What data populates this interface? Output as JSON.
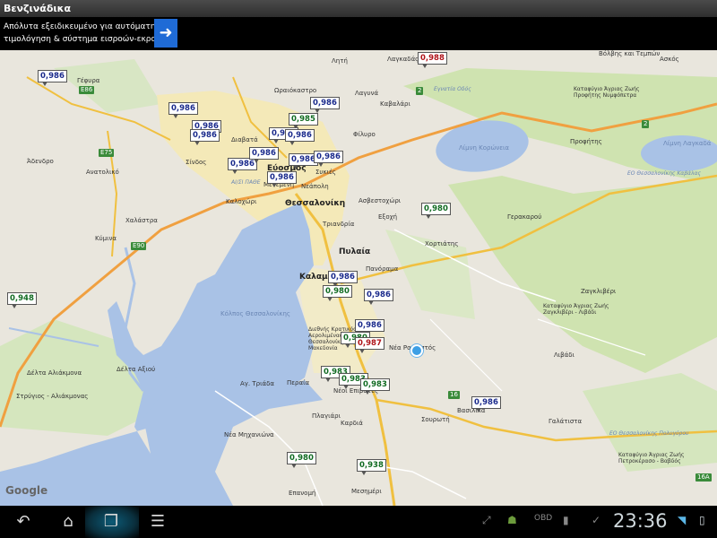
{
  "app": {
    "title": "Βενζινάδικα"
  },
  "ad": {
    "line1": "Απόλυτα εξειδικευμένο για αυτόματη",
    "line2": "τιμολόγηση & σύστημα εισροών-εκροών",
    "button_icon": "arrow-right-icon"
  },
  "map": {
    "attribution": "Google",
    "places": {
      "thessaloniki": "Θεσσαλονίκη",
      "kalamaria": "Καλαμαριά",
      "pylaia": "Πυλαία",
      "panorama": "Πανόραμα",
      "triandria": "Τριανδρία",
      "evosmos": "Εύοσμος",
      "sykies": "Συκιές",
      "neapoli": "Νεάπολη",
      "menemeni": "Μενεμένη",
      "kalochori": "Καλοχώρι",
      "sindos": "Σίνδος",
      "diavata": "Διαβατά",
      "oraiokastro": "Ωραιόκαστρο",
      "filyro": "Φίλυρο",
      "exochi": "Εξοχή",
      "asvestochori": "Ασβεστοχώρι",
      "chortiatis": "Χορτιάτης",
      "peraia": "Περαία",
      "agia_triada": "Αγ. Τριάδα",
      "nea_michaniona": "Νέα Μηχανιώνα",
      "epanomi": "Επανομή",
      "plagiari": "Πλαγιάρι",
      "neoi_epivates": "Νέοι Επιβάτες",
      "kardia": "Καρδιά",
      "souroti": "Σουρωτή",
      "vasilika": "Βασιλικά",
      "galatista": "Γαλάτιστα",
      "nea_raidestos": "Νέα Ραιδεστός",
      "lagkadas": "Λαγκαδάς",
      "lagyna": "Λαγυνά",
      "kavalari": "Καβαλάρι",
      "liti": "Λητή",
      "mesimeri": "Μεσημέρι",
      "chalastra": "Χαλάστρα",
      "kymina": "Κύμινα",
      "adendro": "Άδενδρο",
      "anatoliko": "Ανατολικό",
      "gefyra": "Γέφυρα",
      "delta_axiou": "Δέλτα Αξιού",
      "strygios": "Στρύγιος - Αλιάκμονας",
      "delta_aliakmona": "Δέλτα Αλιάκμονα",
      "koronia": "Λίμνη Κορώνεια",
      "langada_lake": "Λίμνη Λαγκαδά",
      "volvis": "Βόλβης και Τεμπών",
      "askos": "Ασκός",
      "profitis": "Προφήτης",
      "gerakarou": "Γερακαρού",
      "zagkliveri": "Ζαγκλιβέρι",
      "livadi": "Λιβάδι",
      "gulf": "Κόλπος Θεσσαλονίκης",
      "airport": "Διεθνής Κρατικός Αερολιμένας Θεσσαλονίκης Μακεδονία",
      "egnatia": "Εγνατία Οδός",
      "eo_thess_kavalas": "ΕΟ Θεσσαλονίκης Καβάλας",
      "eo_thess_polygyrou": "ΕΟ Θεσσαλονίκης Πολυγύρου",
      "kataf_profiti": "Καταφύγιο Άγριας Ζωής Προφήτης Νυμφόπετρα",
      "kataf_zagkliveri": "Καταφύγιο Άγριας Ζωής Ζαγκλιβέρι - Λιβάδι",
      "kataf_petrokeravo": "Καταφύγιο Άγριας Ζωής Πετροκέρασο - Βαβδός",
      "ais_pathe": "ΑΙ/ΣΙ ΠΑΘΕ"
    },
    "road_shields": [
      "E86",
      "E75",
      "2",
      "E90",
      "16",
      "16A",
      "2"
    ],
    "prices": [
      {
        "value": "0,986",
        "color": "blue"
      },
      {
        "value": "0,988",
        "color": "red"
      },
      {
        "value": "0,986",
        "color": "blue"
      },
      {
        "value": "0,986",
        "color": "blue"
      },
      {
        "value": "0,985",
        "color": "green"
      },
      {
        "value": "0,986",
        "color": "blue"
      },
      {
        "value": "0,986",
        "color": "blue"
      },
      {
        "value": "0,986",
        "color": "blue"
      },
      {
        "value": "0,986",
        "color": "blue"
      },
      {
        "value": "0,986",
        "color": "blue"
      },
      {
        "value": "0,986",
        "color": "blue"
      },
      {
        "value": "0,986",
        "color": "blue"
      },
      {
        "value": "0,986",
        "color": "blue"
      },
      {
        "value": "0,986",
        "color": "blue"
      },
      {
        "value": "0,986",
        "color": "blue"
      },
      {
        "value": "0,980",
        "color": "green"
      },
      {
        "value": "0,948",
        "color": "green"
      },
      {
        "value": "0,980",
        "color": "green"
      },
      {
        "value": "0,986",
        "color": "blue"
      },
      {
        "value": "0,986",
        "color": "blue"
      },
      {
        "value": "0,980",
        "color": "green"
      },
      {
        "value": "0,987",
        "color": "red"
      },
      {
        "value": "0,983",
        "color": "green"
      },
      {
        "value": "0,983",
        "color": "green"
      },
      {
        "value": "0,983",
        "color": "green"
      },
      {
        "value": "0,986",
        "color": "blue"
      },
      {
        "value": "0,980",
        "color": "green"
      },
      {
        "value": "0,938",
        "color": "green"
      }
    ]
  },
  "navbar": {
    "back_icon": "back-icon",
    "home_icon": "home-icon",
    "recents_icon": "recent-apps-icon",
    "menu_icon": "menu-icon",
    "clock": "23:36"
  },
  "colors": {
    "price_blue": "#1a2a8c",
    "price_green": "#116b22",
    "price_red": "#b0141a",
    "water": "#a9c2e6",
    "park": "#cfe3b0"
  }
}
